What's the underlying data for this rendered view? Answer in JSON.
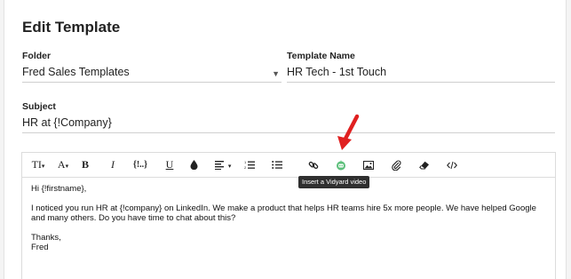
{
  "dialog": {
    "title": "Edit Template"
  },
  "folder": {
    "label": "Folder",
    "value": "Fred Sales Templates"
  },
  "template_name": {
    "label": "Template Name",
    "value": "HR Tech - 1st Touch"
  },
  "subject": {
    "label": "Subject",
    "value": "HR at {!Company}"
  },
  "toolbar": {
    "text_style": "TI",
    "font_color": "A",
    "bold": "B",
    "italic": "I",
    "merge_field": "{!..}",
    "underline": "U",
    "vidyard_tooltip": "Insert a Vidyard video"
  },
  "email_body": {
    "greeting": "Hi {!firstname},",
    "paragraph": "I noticed you run HR at {!company} on LinkedIn. We make a product that helps HR teams hire 5x more people. We have helped Google and many others. Do you have time to chat about this?",
    "closing": "Thanks,",
    "signature": "Fred"
  },
  "colors": {
    "vidyard_icon": "#5bbf7a",
    "arrow": "#e02020",
    "tooltip_bg": "#2f2f2f"
  }
}
